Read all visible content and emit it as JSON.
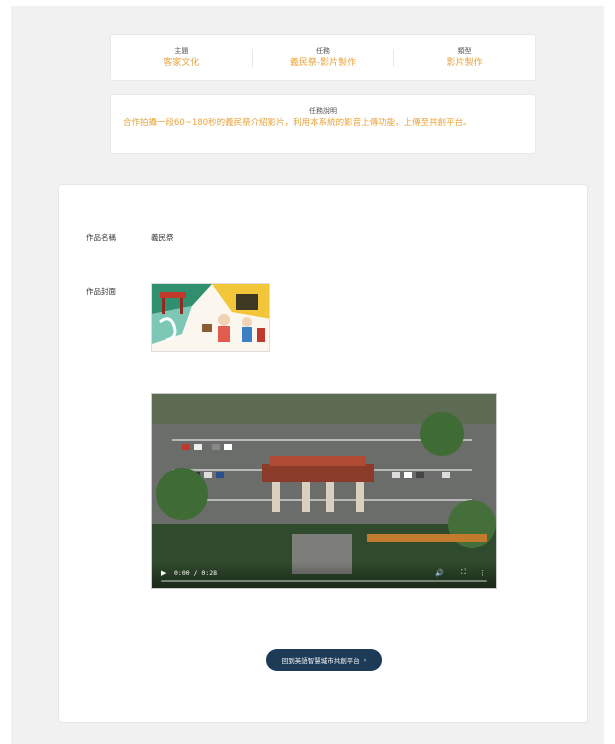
{
  "info": {
    "theme_label": "主題",
    "theme_value": "客家文化",
    "task_label": "任務",
    "task_value": "義民祭-影片製作",
    "type_label": "類型",
    "type_value": "影片製作"
  },
  "task_desc": {
    "label": "任務說明",
    "text": "合作拍攝一段60~180秒的義民祭介紹影片，利用本系統的影音上傳功能，上傳至共創平台。"
  },
  "work": {
    "name_label": "作品名稱",
    "name_value": "義民祭",
    "cover_label": "作品封面"
  },
  "video": {
    "time": "0:00 / 0:28",
    "progress": 0
  },
  "back_button": {
    "label": "回到英語智慧城市共創平台",
    "chevron": "›"
  }
}
